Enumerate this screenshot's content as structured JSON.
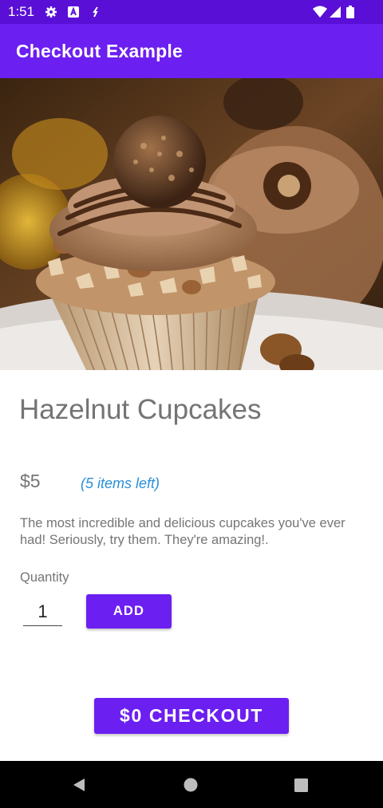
{
  "status_bar": {
    "time": "1:51",
    "icons": [
      "gear-icon",
      "a-badge-icon",
      "sync-icon",
      "wifi-icon",
      "signal-icon",
      "battery-icon"
    ]
  },
  "app_bar": {
    "title": "Checkout Example"
  },
  "product": {
    "image_label": "hazelnut-cupcake-photo",
    "title": "Hazelnut Cupcakes",
    "price": "$5",
    "stock": "(5 items left)",
    "description": "The most incredible and delicious cupcakes you've ever had! Seriously, try them. They're amazing!."
  },
  "quantity": {
    "label": "Quantity",
    "value": "1"
  },
  "buttons": {
    "add": "ADD",
    "checkout": "$0 CHECKOUT"
  },
  "nav_bar": {
    "icons": [
      "back-icon",
      "home-icon",
      "recents-icon"
    ]
  },
  "colors": {
    "primary": "#6c1ff1",
    "status_bar": "#5a0fd6",
    "accent_text": "#2a8fd8"
  }
}
